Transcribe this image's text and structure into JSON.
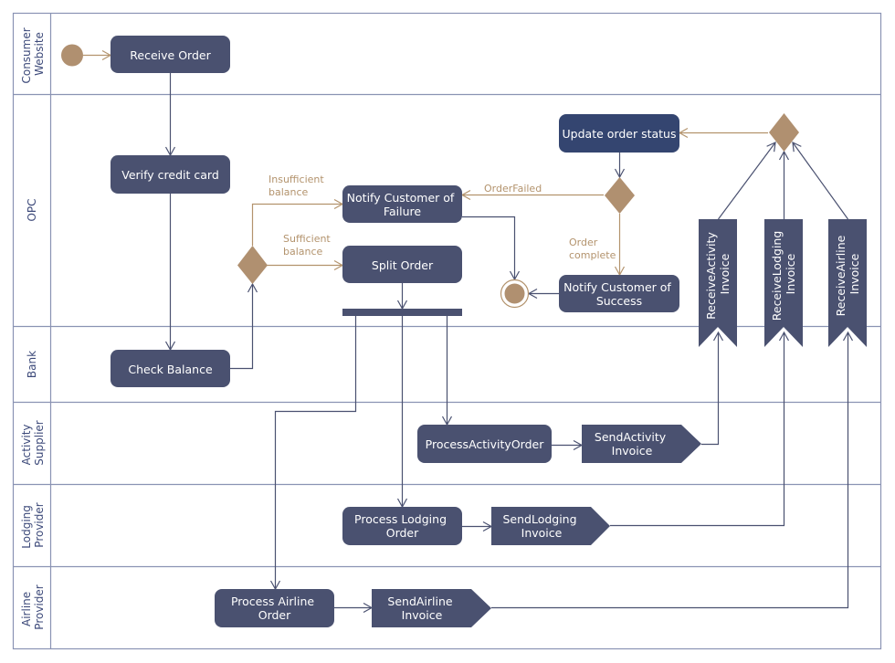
{
  "colors": {
    "node": "#4a5170",
    "node_highlight": "#344570",
    "control": "#b09070",
    "flow": "#4a5170",
    "guard_flow": "#b3936d",
    "lane_border": "#8a93b3",
    "lane_text": "#3d4a7a"
  },
  "lanes": [
    {
      "id": "consumer",
      "label_lines": [
        "Consumer",
        "Website"
      ]
    },
    {
      "id": "opc",
      "label_lines": [
        "OPC"
      ]
    },
    {
      "id": "bank",
      "label_lines": [
        "Bank"
      ]
    },
    {
      "id": "activity",
      "label_lines": [
        "Activity",
        "Supplier"
      ]
    },
    {
      "id": "lodging",
      "label_lines": [
        "Lodging",
        "Provider"
      ]
    },
    {
      "id": "airline",
      "label_lines": [
        "Airline",
        "Provider"
      ]
    }
  ],
  "actions": {
    "receive_order": {
      "lines": [
        "Receive Order"
      ]
    },
    "verify_credit_card": {
      "lines": [
        "Verify credit card"
      ]
    },
    "check_balance": {
      "lines": [
        "Check Balance"
      ]
    },
    "notify_failure": {
      "lines": [
        "Notify Customer of",
        "Failure"
      ]
    },
    "split_order": {
      "lines": [
        "Split Order"
      ]
    },
    "update_order_status": {
      "lines": [
        "Update order status"
      ]
    },
    "notify_success": {
      "lines": [
        "Notify Customer of",
        "Success"
      ]
    },
    "process_activity_order": {
      "lines": [
        "ProcessActivityOrder"
      ]
    },
    "process_lodging_order": {
      "lines": [
        "Process Lodging",
        "Order"
      ]
    },
    "process_airline_order": {
      "lines": [
        "Process Airline",
        "Order"
      ]
    }
  },
  "send_signals": {
    "send_activity_invoice": {
      "lines": [
        "SendActivity",
        "Invoice"
      ]
    },
    "send_lodging_invoice": {
      "lines": [
        "SendLodging",
        "Invoice"
      ]
    },
    "send_airline_invoice": {
      "lines": [
        "SendAirline",
        "Invoice"
      ]
    }
  },
  "accept_events": {
    "receive_activity_invoice": {
      "lines": [
        "ReceiveActivity",
        "Invoice"
      ]
    },
    "receive_lodging_invoice": {
      "lines": [
        "ReceiveLodging",
        "Invoice"
      ]
    },
    "receive_airline_invoice": {
      "lines": [
        "ReceiveAirline",
        "Invoice"
      ]
    }
  },
  "guards": {
    "insufficient_balance": [
      "Insufficient",
      "balance"
    ],
    "sufficient_balance": [
      "Sufficient",
      "balance"
    ],
    "order_failed": [
      "OrderFailed"
    ],
    "order_complete": [
      "Order",
      "complete"
    ]
  }
}
